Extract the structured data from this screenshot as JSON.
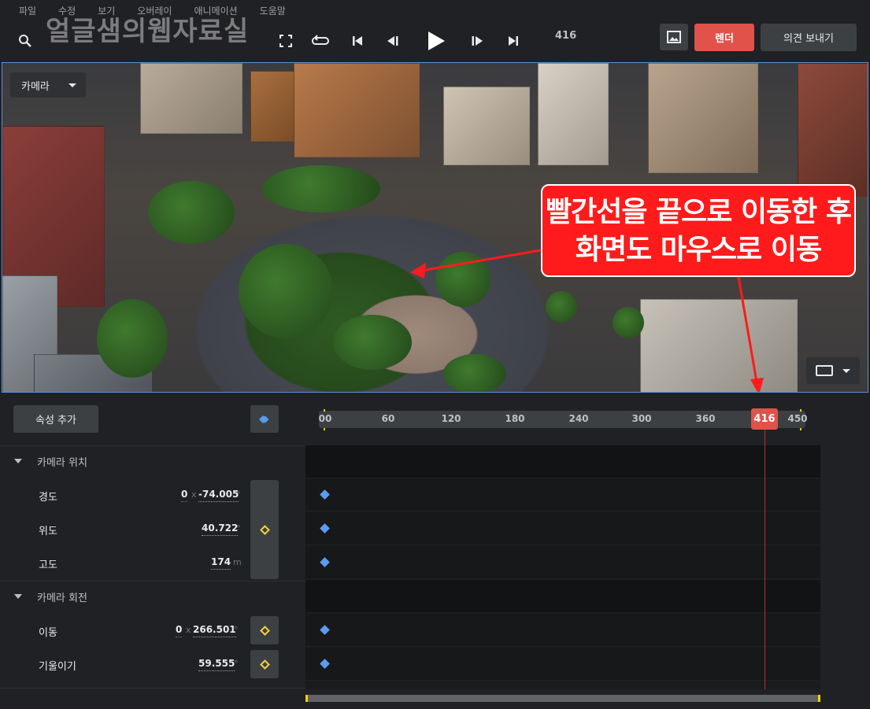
{
  "menu": [
    "파일",
    "수정",
    "보기",
    "오버레이",
    "애니메이션",
    "도움말"
  ],
  "watermark": "얼글샘의웹자료실",
  "toolbar": {
    "frame": "416",
    "render_label": "렌더",
    "feedback_label": "의견 보내기"
  },
  "viewport": {
    "camera_dropdown": "카메라",
    "callout_line1": "빨간선을 끝으로 이동한 후",
    "callout_line2": "화면도 마우스로 이동"
  },
  "panel": {
    "add_property": "속성 추가",
    "ruler_ticks": [
      "00",
      "60",
      "120",
      "180",
      "240",
      "300",
      "360",
      "450"
    ],
    "playhead": "416",
    "groups": [
      {
        "label": "카메라 위치"
      },
      {
        "label": "카메라 회전"
      }
    ],
    "props": {
      "longitude": {
        "label": "경도",
        "x": "0",
        "x_sep": "x",
        "value": "-74.005",
        "unit": "°"
      },
      "latitude": {
        "label": "위도",
        "value": "40.722",
        "unit": "°"
      },
      "altitude": {
        "label": "고도",
        "value": "174",
        "unit": "m"
      },
      "pan": {
        "label": "이동",
        "x": "0",
        "x_sep": "x",
        "value": "266.501",
        "unit": "°"
      },
      "tilt": {
        "label": "기울이기",
        "value": "59.555",
        "unit": "°"
      }
    }
  },
  "colors": {
    "accent_red": "#e0524a",
    "keyframe_blue": "#5b9bf0",
    "keyframe_yellow": "#f4d03f",
    "callout_red": "#ff1b1b"
  }
}
